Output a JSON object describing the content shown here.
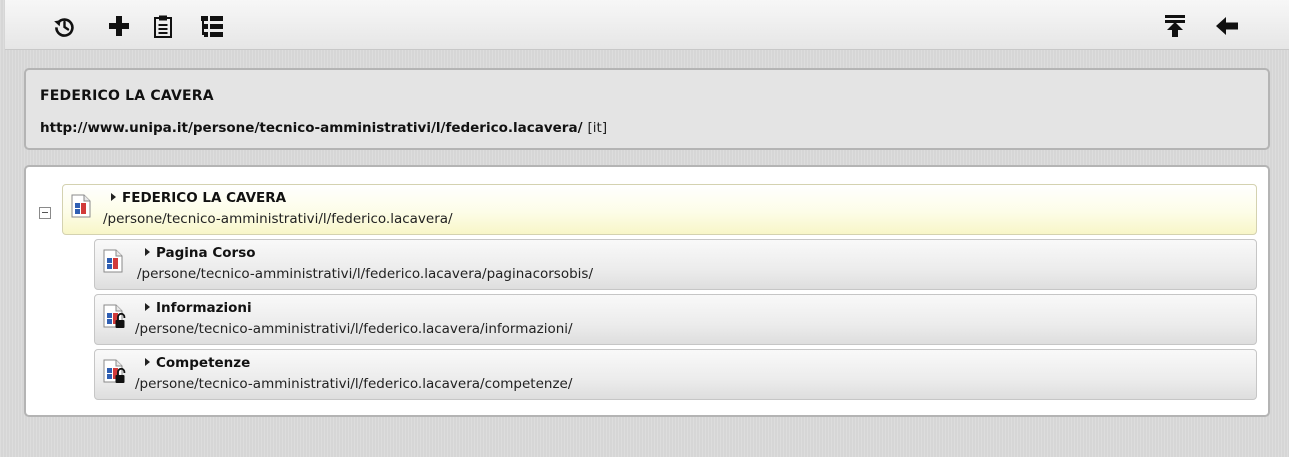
{
  "toolbar": {
    "left_icons": [
      "history-icon",
      "plus-icon",
      "clipboard-icon",
      "tree-structure-icon"
    ],
    "right_icons": [
      "move-to-top-icon",
      "arrow-left-icon"
    ]
  },
  "header": {
    "title": "FEDERICO LA CAVERA",
    "url": "http://www.unipa.it/persone/tecnico-amministrativi/l/federico.lacavera/",
    "language": "[it]"
  },
  "tree": {
    "root": {
      "title": "FEDERICO LA CAVERA",
      "path": "/persone/tecnico-amministrativi/l/federico.lacavera/",
      "icon": "page-icon"
    },
    "children": [
      {
        "title": "Pagina Corso",
        "path": "/persone/tecnico-amministrativi/l/federico.lacavera/paginacorsobis/",
        "icon": "page-icon"
      },
      {
        "title": "Informazioni",
        "path": "/persone/tecnico-amministrativi/l/federico.lacavera/informazioni/",
        "icon": "page-lock-icon"
      },
      {
        "title": "Competenze",
        "path": "/persone/tecnico-amministrativi/l/federico.lacavera/competenze/",
        "icon": "page-lock-icon"
      }
    ]
  },
  "colors": {
    "root_highlight": "#fdfde8",
    "panel_border": "#b4b4b4",
    "icon_blue": "#2f5fb3",
    "icon_red": "#d23a3a"
  }
}
